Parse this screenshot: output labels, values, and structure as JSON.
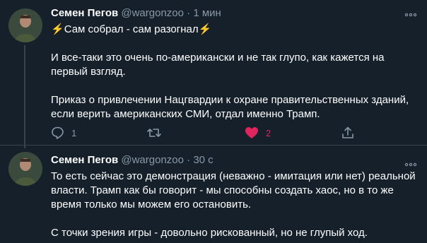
{
  "colors": {
    "background": "#15202b",
    "text": "#ffffff",
    "secondary": "#8899a6",
    "divider": "#38444d",
    "like": "#e0245e",
    "bolt": "#ffd23e"
  },
  "tweets": [
    {
      "author_name": "Семен Пегов",
      "handle": "@wargonzoo",
      "separator": "·",
      "time": "1 мин",
      "title_emoji_left": "⚡",
      "title_text": "Сам собрал - сам разогнал",
      "title_emoji_right": "⚡",
      "paragraph1": "И все-таки это очень по-американски и не так глупо, как кажется на первый взгляд.",
      "paragraph2": "Приказ о привлечении Нацгвардии к охране правительственных зданий, если верить американских СМИ, отдал именно Трамп.",
      "reply_count": "1",
      "like_count": "2",
      "icons": [
        "reply-icon",
        "retweet-icon",
        "heart-icon",
        "share-icon",
        "more-icon"
      ]
    },
    {
      "author_name": "Семен Пегов",
      "handle": "@wargonzoo",
      "separator": "·",
      "time": "30 с",
      "paragraph1": "То есть сейчас это демонстрация (неважно - имитация или нет) реальной власти. Трамп как бы говорит - мы способны создать хаос, но в то же время только мы можем его остановить.",
      "paragraph2": "С точки зрения игры - довольно рискованный, но не глупый ход."
    }
  ]
}
